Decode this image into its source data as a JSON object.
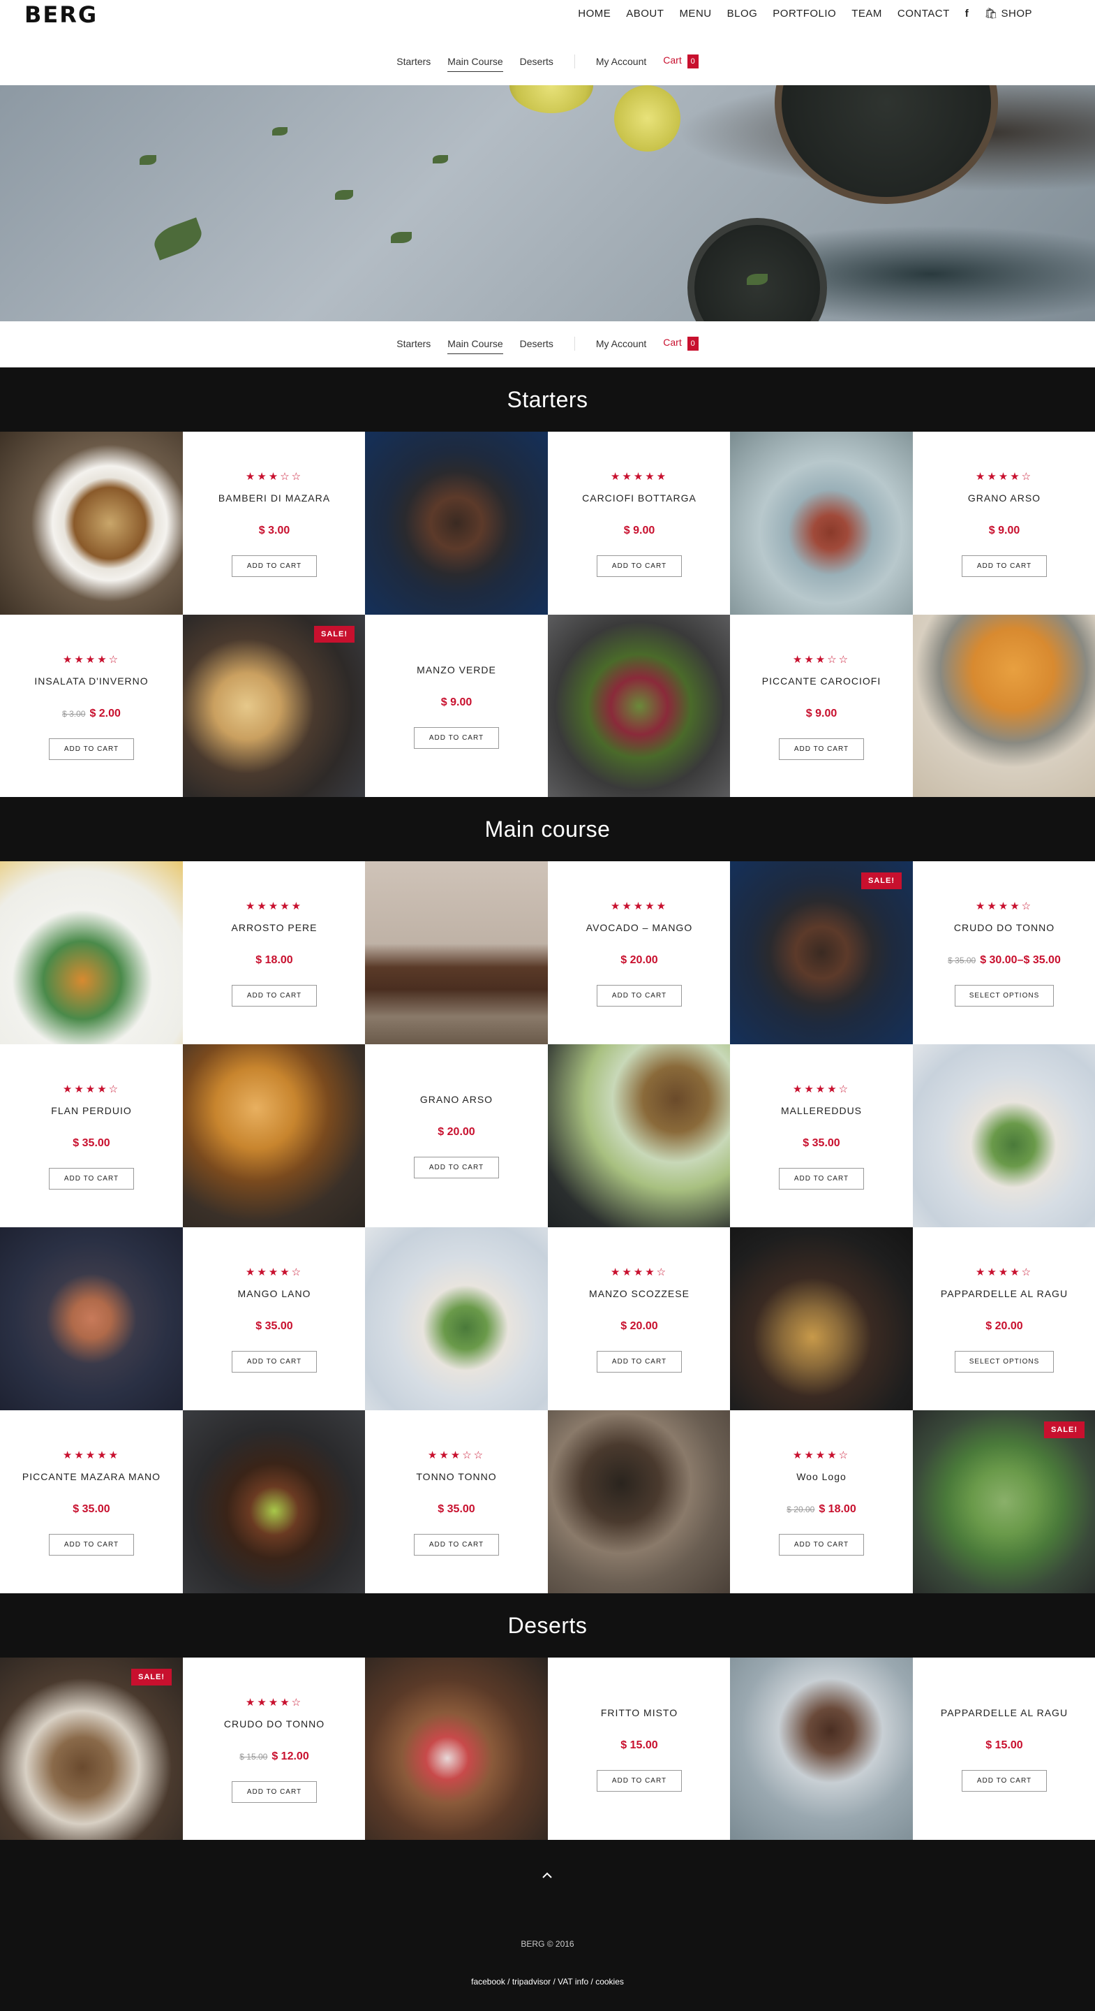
{
  "brand": {
    "logo": "BERG"
  },
  "main_nav": {
    "home": "HOME",
    "about": "ABOUT",
    "menu": "MENU",
    "blog": "BLOG",
    "portfolio": "PORTFOLIO",
    "team": "TEAM",
    "contact": "CONTACT",
    "facebook": "f",
    "shop": "SHOP"
  },
  "sub_nav": {
    "starters": "Starters",
    "main_course": "Main Course",
    "deserts": "Deserts",
    "my_account": "My Account",
    "cart": "Cart",
    "cart_count": "0"
  },
  "sections": {
    "starters": "Starters",
    "main_course": "Main course",
    "deserts": "Deserts"
  },
  "starters": [
    {
      "name": "BAMBERI DI MAZARA",
      "rating": 3,
      "price": "$ 3.00",
      "button": "ADD TO CART"
    },
    {
      "name": "CARCIOFI BOTTARGA",
      "rating": 5,
      "price": "$ 9.00",
      "button": "ADD TO CART"
    },
    {
      "name": "GRANO ARSO",
      "rating": 4,
      "price": "$ 9.00",
      "button": "ADD TO CART"
    },
    {
      "name": "INSALATA D'INVERNO",
      "rating": 4,
      "old_price": "$ 3.00",
      "price": "$ 2.00",
      "button": "ADD TO CART"
    },
    {
      "name": "MANZO VERDE",
      "rating": 0,
      "price": "$ 9.00",
      "button": "ADD TO CART"
    },
    {
      "name": "PICCANTE CAROCIOFI",
      "rating": 3,
      "price": "$ 9.00",
      "button": "ADD TO CART"
    }
  ],
  "main": [
    {
      "name": "ARROSTO PERE",
      "rating": 5,
      "price": "$ 18.00",
      "button": "ADD TO CART"
    },
    {
      "name": "AVOCADO – MANGO",
      "rating": 5,
      "price": "$ 20.00",
      "button": "ADD TO CART"
    },
    {
      "name": "CRUDO DO TONNO",
      "rating": 4,
      "old_price": "$ 35.00",
      "price": "$ 30.00–$ 35.00",
      "button": "SELECT OPTIONS"
    },
    {
      "name": "FLAN PERDUIO",
      "rating": 4,
      "price": "$ 35.00",
      "button": "ADD TO CART"
    },
    {
      "name": "GRANO ARSO",
      "rating": 0,
      "price": "$ 20.00",
      "button": "ADD TO CART"
    },
    {
      "name": "MALLEREDDUS",
      "rating": 4,
      "price": "$ 35.00",
      "button": "ADD TO CART"
    },
    {
      "name": "MANGO LANO",
      "rating": 4,
      "price": "$ 35.00",
      "button": "ADD TO CART"
    },
    {
      "name": "MANZO SCOZZESE",
      "rating": 4,
      "price": "$ 20.00",
      "button": "ADD TO CART"
    },
    {
      "name": "PAPPARDELLE AL RAGU",
      "rating": 4,
      "price": "$ 20.00",
      "button": "SELECT OPTIONS"
    },
    {
      "name": "PICCANTE MAZARA MANO",
      "rating": 4.5,
      "price": "$ 35.00",
      "button": "ADD TO CART"
    },
    {
      "name": "TONNO TONNO",
      "rating": 3,
      "price": "$ 35.00",
      "button": "ADD TO CART"
    },
    {
      "name": "Woo Logo",
      "rating": 4,
      "old_price": "$ 20.00",
      "price": "$ 18.00",
      "button": "ADD TO CART"
    }
  ],
  "deserts": [
    {
      "name": "CRUDO DO TONNO",
      "rating": 4,
      "old_price": "$ 15.00",
      "price": "$ 12.00",
      "button": "ADD TO CART"
    },
    {
      "name": "FRITTO MISTO",
      "rating": 0,
      "price": "$ 15.00",
      "button": "ADD TO CART"
    },
    {
      "name": "PAPPARDELLE AL RAGU",
      "rating": 0,
      "price": "$ 15.00",
      "button": "ADD TO CART"
    }
  ],
  "sale_label": "SALE!",
  "footer": {
    "copyright": "BERG © 2016",
    "links": "facebook / tripadvisor / VAT info / cookies",
    "up_icon": "chevron-up-icon"
  },
  "colors": {
    "accent": "#c8102e",
    "dark": "#111111"
  }
}
